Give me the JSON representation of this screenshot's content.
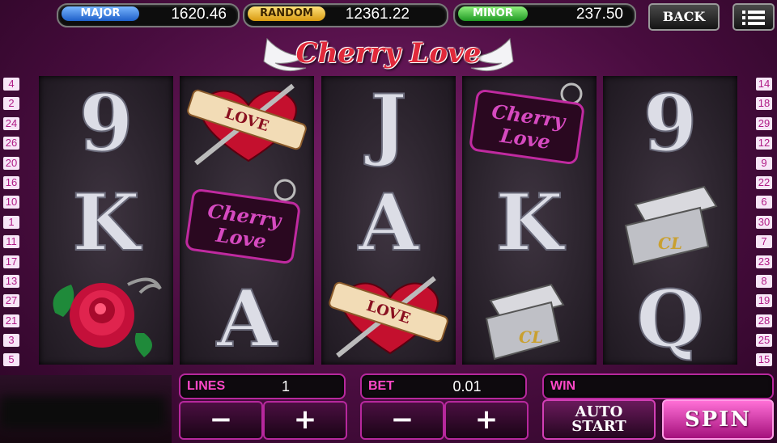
{
  "jackpots": {
    "major": {
      "label": "MAJOR",
      "value": "1620.46"
    },
    "random": {
      "label": "RANDOM",
      "value": "12361.22"
    },
    "minor": {
      "label": "MINOR",
      "value": "237.50"
    }
  },
  "header": {
    "back_label": "BACK",
    "menu_icon": "menu-icon"
  },
  "logo": {
    "text": "Cherry Love"
  },
  "left_lines": [
    "4",
    "2",
    "24",
    "26",
    "20",
    "16",
    "10",
    "1",
    "11",
    "17",
    "13",
    "27",
    "21",
    "3",
    "5"
  ],
  "right_lines": [
    "14",
    "18",
    "29",
    "12",
    "9",
    "22",
    "6",
    "30",
    "7",
    "23",
    "8",
    "19",
    "28",
    "25",
    "15"
  ],
  "reels": [
    [
      "9",
      "K",
      "rose"
    ],
    [
      "heart",
      "cherry-love-tag",
      "A"
    ],
    [
      "J",
      "A",
      "heart"
    ],
    [
      "cherry-love-tag",
      "K",
      "lighter"
    ],
    [
      "9",
      "lighter",
      "Q"
    ]
  ],
  "controls": {
    "lines_label": "LINES",
    "lines_value": "1",
    "bet_label": "BET",
    "bet_value": "0.01",
    "win_label": "WIN",
    "win_value": "",
    "minus": "−",
    "plus": "+",
    "auto_line1": "AUTO",
    "auto_line2": "START",
    "spin_label": "SPIN"
  },
  "colors": {
    "accent": "#b7289d",
    "label_pink": "#ff48c8",
    "background": "#4a0d40"
  }
}
